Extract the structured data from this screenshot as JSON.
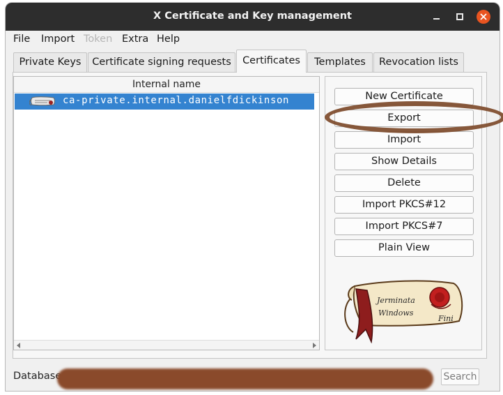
{
  "window": {
    "title": "X Certificate and Key management"
  },
  "menu": {
    "file": "File",
    "import": "Import",
    "token": "Token",
    "extra": "Extra",
    "help": "Help"
  },
  "tabs": [
    "Private Keys",
    "Certificate signing requests",
    "Certificates",
    "Templates",
    "Revocation lists"
  ],
  "tree": {
    "header": "Internal name",
    "rows": [
      {
        "name": "ca-private.internal.danielfdickinson",
        "icon": "certificate-icon"
      }
    ]
  },
  "actions": [
    "New Certificate",
    "Export",
    "Import",
    "Show Details",
    "Delete",
    "Import PKCS#12",
    "Import PKCS#7",
    "Plain View"
  ],
  "logo": {
    "line1": "Jerminata",
    "line2": "Windows",
    "line3": "Fini"
  },
  "footer": {
    "database_label": "Database:",
    "search_label": "Search"
  },
  "colors": {
    "selection": "#3483d0",
    "annotation": "#7d4a2a",
    "close": "#e95420"
  }
}
